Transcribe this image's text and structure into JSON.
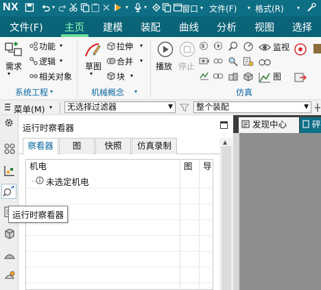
{
  "titlebar": {
    "logo": "NX",
    "menus": [
      "窗口",
      "文件(F)",
      "格式(R)"
    ],
    "dropdown_glyph": "▾"
  },
  "ribbon_tabs": [
    "文件(F)",
    "主页",
    "建模",
    "装配",
    "曲线",
    "分析",
    "视图",
    "选择"
  ],
  "active_tab": "主页",
  "ribbon": {
    "system_engineering": {
      "requirements_label": "需求",
      "function_label": "功能",
      "logic_label": "逻辑",
      "related_objects_label": "相关对象",
      "group_label": "系统工程"
    },
    "mechanical_concept": {
      "sketch_label": "草图",
      "extrude_label": "拉伸",
      "unite_label": "合并",
      "block_label": "块",
      "group_label": "机械概念"
    },
    "simulation": {
      "play_label": "播放",
      "stop_label": "停止",
      "monitor_label": "监视",
      "graph_label": "图",
      "group_label": "仿真"
    }
  },
  "selection_bar": {
    "menu_label": "菜单(M)",
    "filter_value": "无选择过滤器",
    "scope_value": "整个装配"
  },
  "runtime_viewer": {
    "title": "运行时察看器",
    "tabs": [
      "察看器",
      "图",
      "快照",
      "仿真录制"
    ],
    "active_tab": "察看器",
    "columns": [
      "机电",
      "图",
      "导"
    ],
    "rows": [
      {
        "label": "未选定机电"
      }
    ]
  },
  "right_tabs": {
    "discovery_center": "发现中心",
    "second_tab_fragment": "砰"
  },
  "tooltip": "运行时察看器",
  "colors": {
    "titlebar": "#0d6e84",
    "ribbon_tabs_bg": "#0a6377",
    "active_tab_text": "#8bffb3",
    "group_label": "#0b67a0"
  }
}
